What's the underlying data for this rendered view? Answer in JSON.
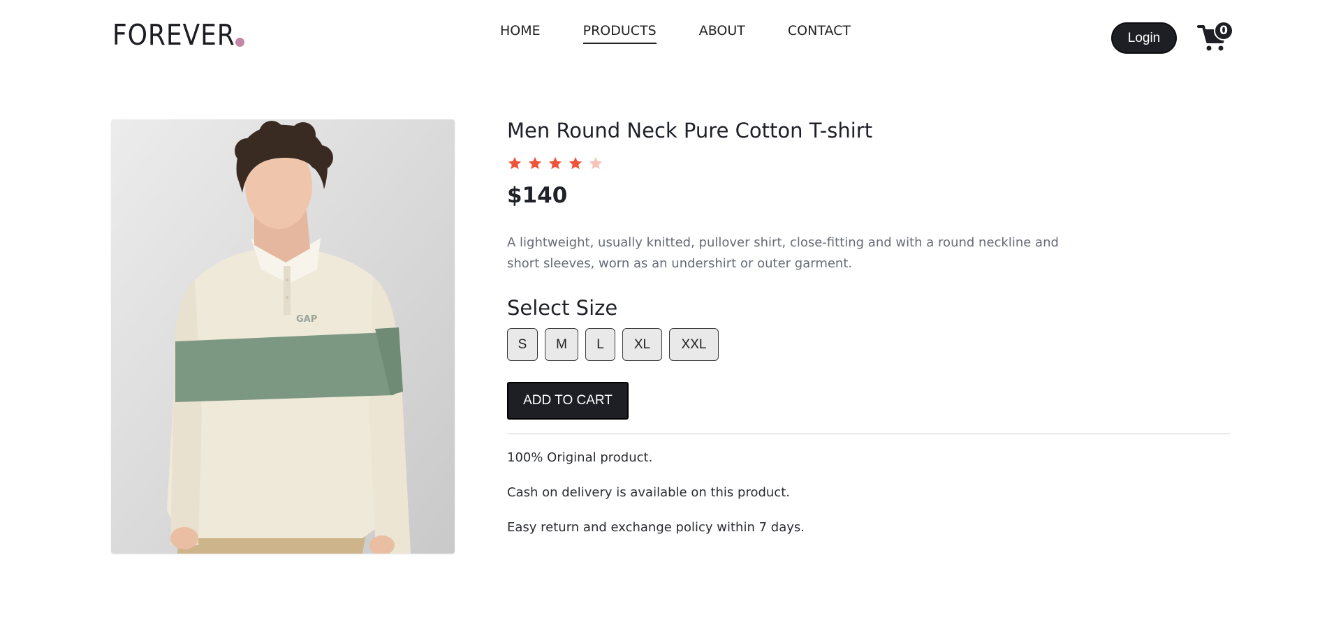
{
  "header": {
    "logo_text": "FOREVER",
    "logo_dot_color": "#c586a5",
    "nav": [
      {
        "label": "HOME"
      },
      {
        "label": "PRODUCTS",
        "active": true
      },
      {
        "label": "ABOUT"
      },
      {
        "label": "CONTACT"
      }
    ],
    "login_label": "Login",
    "cart_count": "0",
    "cart_icon": "cart-icon"
  },
  "product": {
    "image_alt": "product-photo",
    "title": "Men Round Neck Pure Cotton T-shirt",
    "rating": 4,
    "rating_max": 5,
    "star_color": "#f0533a",
    "star_empty_color": "#f6c3b8",
    "price": "$140",
    "description": "A lightweight, usually knitted, pullover shirt, close-fitting and with a round neckline and short sleeves, worn as an undershirt or outer garment.",
    "size_heading": "Select Size",
    "sizes": [
      "S",
      "M",
      "L",
      "XL",
      "XXL"
    ],
    "add_to_cart_label": "ADD TO CART",
    "policies": [
      "100% Original product.",
      "Cash on delivery is available on this product.",
      "Easy return and exchange policy within 7 days."
    ]
  }
}
